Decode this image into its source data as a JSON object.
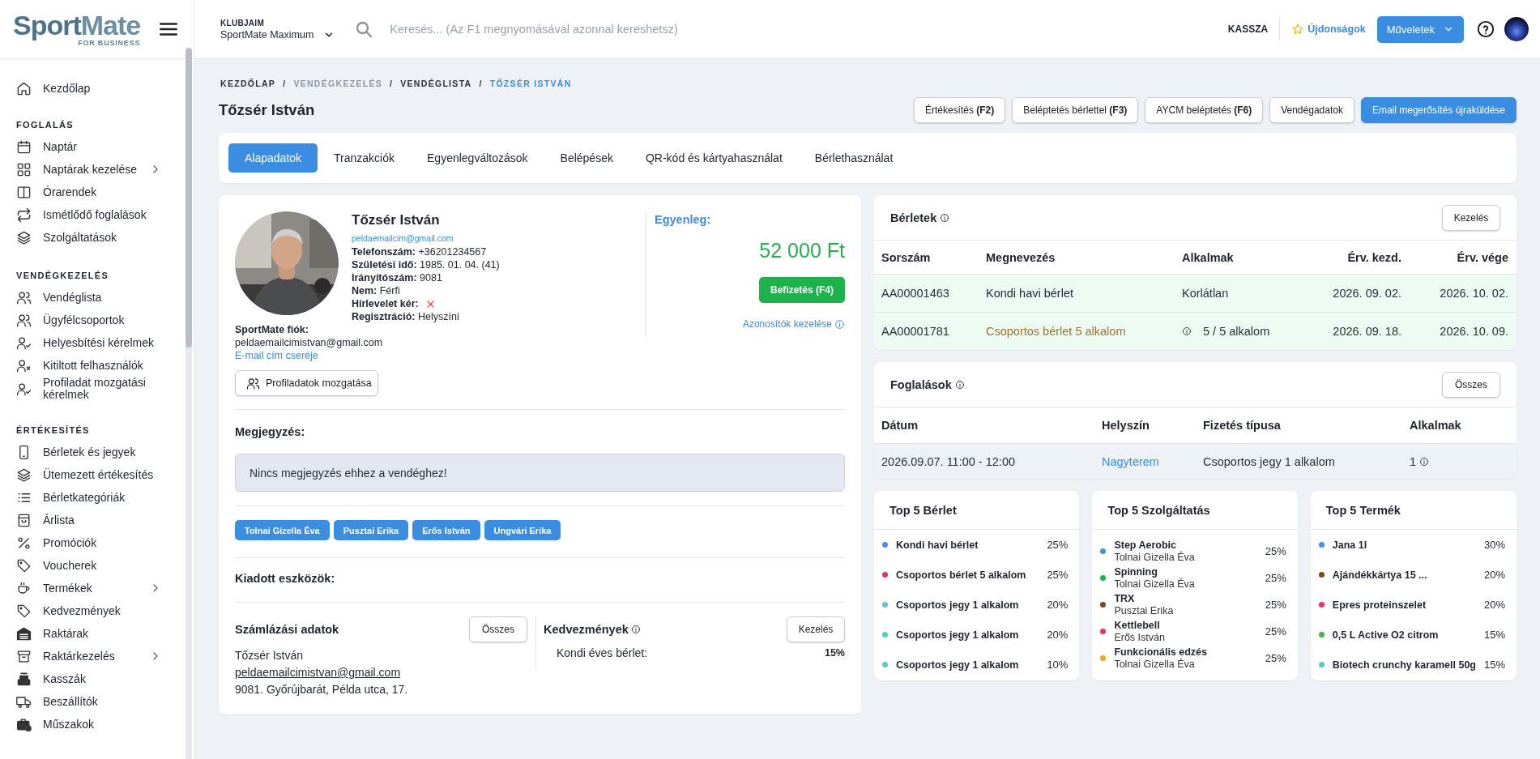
{
  "logo": {
    "wordmark_1": "Sport",
    "wordmark_2": "Mate",
    "tagline": "FOR BUSINESS"
  },
  "sidebar": {
    "sections": [
      {
        "items": [
          {
            "label": "Kezdőlap",
            "has_submenu": false
          }
        ]
      },
      {
        "title": "FOGLALÁS",
        "items": [
          {
            "label": "Naptár",
            "has_submenu": false
          },
          {
            "label": "Naptárak kezelése",
            "has_submenu": true
          },
          {
            "label": "Órarendek",
            "has_submenu": false
          },
          {
            "label": "Ismétlődő foglalások",
            "has_submenu": false
          },
          {
            "label": "Szolgáltatások",
            "has_submenu": false
          }
        ]
      },
      {
        "title": "VENDÉGKEZELÉS",
        "items": [
          {
            "label": "Vendéglista",
            "has_submenu": false
          },
          {
            "label": "Ügyfélcsoportok",
            "has_submenu": false
          },
          {
            "label": "Helyesbítési kérelmek",
            "has_submenu": false
          },
          {
            "label": "Kitiltott felhasználók",
            "has_submenu": false
          },
          {
            "label": "Profiladat mozgatási kérelmek",
            "has_submenu": false
          }
        ]
      },
      {
        "title": "ÉRTÉKESÍTÉS",
        "items": [
          {
            "label": "Bérletek és jegyek",
            "has_submenu": false
          },
          {
            "label": "Ütemezett értékesítés",
            "has_submenu": false
          },
          {
            "label": "Bérletkategóriák",
            "has_submenu": false
          },
          {
            "label": "Árlista",
            "has_submenu": false
          },
          {
            "label": "Promóciók",
            "has_submenu": false
          },
          {
            "label": "Voucherek",
            "has_submenu": false
          },
          {
            "label": "Termékek",
            "has_submenu": true
          },
          {
            "label": "Kedvezmények",
            "has_submenu": false
          },
          {
            "label": "Raktárak",
            "has_submenu": false
          },
          {
            "label": "Raktárkezelés",
            "has_submenu": true
          },
          {
            "label": "Kasszák",
            "has_submenu": false
          },
          {
            "label": "Beszállítók",
            "has_submenu": false
          },
          {
            "label": "Műszakok",
            "has_submenu": false
          }
        ]
      }
    ]
  },
  "topbar": {
    "club_label": "KLUBJAIM",
    "club": "SportMate Maximum",
    "search": {
      "placeholder": "Keresés... (Az F1 megnyomásával azonnal kereshetsz)"
    },
    "register_link": "KASSZA",
    "news_link": "Újdonságok",
    "actions_button": "Műveletek"
  },
  "breadcrumbs": [
    {
      "label": "KEZDŐLAP",
      "kind": "link"
    },
    {
      "label": "/",
      "kind": "separator"
    },
    {
      "label": "VENDÉGKEZELÉS",
      "kind": "muted"
    },
    {
      "label": "/",
      "kind": "separator"
    },
    {
      "label": "VENDÉGLISTA",
      "kind": "link"
    },
    {
      "label": "/",
      "kind": "separator"
    },
    {
      "label": "TŐZSÉR ISTVÁN",
      "kind": "current"
    }
  ],
  "page_title": "Tőzsér István",
  "action_buttons": [
    {
      "label": "Értékesítés **(F2)**",
      "kind": "default"
    },
    {
      "label": "Beléptetés bérlettel **(F3)**",
      "kind": "default"
    },
    {
      "label": "AYCM beléptetés **(F6)**",
      "kind": "default"
    },
    {
      "label": "Vendégadatok",
      "kind": "default"
    },
    {
      "label": "Email megerősítés újraküldése",
      "kind": "primary"
    }
  ],
  "tabs": [
    {
      "label": "Alapadatok",
      "selected": true
    },
    {
      "label": "Tranzakciók",
      "selected": false
    },
    {
      "label": "Egyenlegváltozások",
      "selected": false
    },
    {
      "label": "Belépések",
      "selected": false
    },
    {
      "label": "QR-kód és kártyahasználat",
      "selected": false
    },
    {
      "label": "Bérlethasználat",
      "selected": false
    }
  ],
  "profile": {
    "photo": {
      "kind": "picture"
    },
    "name": "Tőzsér István",
    "email": "peldaemailcim@gmail.com",
    "fields": [
      {
        "kind": "text",
        "label": "Telefonszám:",
        "value": "+36201234567"
      },
      {
        "kind": "text",
        "label": "Születési idő:",
        "value": "1985. 01. 04. (41)"
      },
      {
        "kind": "text",
        "label": "Irányítószám:",
        "value": "9081"
      },
      {
        "kind": "text",
        "label": "Nem:",
        "value": "Férfi"
      },
      {
        "kind": "flag",
        "label": "Hírlevelet kér:",
        "on": false
      },
      {
        "kind": "text",
        "label": "Regisztráció:",
        "value": "Helyszíni"
      }
    ],
    "account_label": "SportMate fiók:",
    "account_email": "peldaemailcimistvan@gmail.com",
    "change_email_link": "E-mail cím cseréje",
    "move_button": "Profiladatok mozgatása",
    "balance": {
      "label": "Egyenleg:",
      "amount": "52 000 Ft",
      "pay_button": "Befizetés (F4)",
      "ids_link": "Azonosítók kezelése"
    },
    "note_label": "Megjegyzés:",
    "note": "Nincs megjegyzés ehhez a vendéghez!",
    "trainers": [
      "Tolnai Gizella Éva",
      "Pusztai Erika",
      "Erős István",
      "Ungvári Erika"
    ],
    "devices_label": "Kiadott eszközök:",
    "billing": {
      "title": "Számlázási adatok",
      "button": "Összes",
      "name": "Tőzsér István",
      "email": "peldaemailcimistvan@gmail.com",
      "address": "9081. Győrújbarát, Példa utca, 17."
    },
    "discounts": {
      "title": "Kedvezmények",
      "button": "Kezelés",
      "rows": [
        {
          "name": "Kondi éves bérlet:",
          "value": "15%"
        }
      ]
    }
  },
  "passes": {
    "title": "Bérletek",
    "button": "Kezelés",
    "columns": [
      "Sorszám",
      "Megnevezés",
      "Alkalmak",
      "Érv. kezd.",
      "Érv. vége"
    ],
    "rows": [
      {
        "active": true,
        "used_up": false,
        "has_info": false,
        "cells": [
          "AA00001463",
          "Kondi havi bérlet",
          "Korlátlan",
          "2026. 09. 02.",
          "2026. 10. 02."
        ]
      },
      {
        "active": true,
        "used_up": true,
        "has_info": true,
        "cells": [
          "AA00001781",
          "Csoportos bérlet 5 alkalom",
          "5 / 5 alkalom",
          "2026. 09. 18.",
          "2026. 10. 09."
        ]
      }
    ]
  },
  "bookings": {
    "title": "Foglalások",
    "button": "Összes",
    "columns": [
      "Dátum",
      "Helyszín",
      "Fizetés típusa",
      "Alkalmak"
    ],
    "rows": [
      {
        "cells": [
          "2026.09.07. 11:00 - 12:00",
          "Nagyterem",
          "Csoportos jegy 1 alkalom",
          "1"
        ]
      }
    ]
  },
  "top5": [
    {
      "title": "Top 5 Bérlet",
      "items": [
        {
          "name": "Kondi havi bérlet",
          "percent": "25%",
          "color": "#4a8fd8"
        },
        {
          "name": "Csoportos bérlet 5 alkalom",
          "percent": "25%",
          "color": "#e2336f"
        },
        {
          "name": "Csoportos jegy 1 alkalom",
          "percent": "20%",
          "color": "#5cc9c9"
        },
        {
          "name": "Csoportos jegy 1 alkalom",
          "percent": "20%",
          "color": "#5cc9c9"
        },
        {
          "name": "Csoportos jegy 1 alkalom",
          "percent": "10%",
          "color": "#5cc9c9"
        }
      ]
    },
    {
      "title": "Top 5 Szolgáltatás",
      "items": [
        {
          "name": "Step Aerobic",
          "trainer": "Tolnai Gizella Éva",
          "percent": "25%",
          "color": "#4a8fd8"
        },
        {
          "name": "Spinning",
          "trainer": "Tolnai Gizella Éva",
          "percent": "25%",
          "color": "#1faf4b"
        },
        {
          "name": "TRX",
          "trainer": "Pusztai Erika",
          "percent": "25%",
          "color": "#7b4a1d"
        },
        {
          "name": "Kettlebell",
          "trainer": "Erős István",
          "percent": "25%",
          "color": "#e2336f"
        },
        {
          "name": "Funkcionális edzés",
          "trainer": "Tolnai Gizella Éva",
          "percent": "25%",
          "color": "#f5a623"
        }
      ]
    },
    {
      "title": "Top 5 Termék",
      "items": [
        {
          "name": "Jana 1l",
          "percent": "30%",
          "color": "#4a8fd8"
        },
        {
          "name": "Ajándékkártya 15 ...",
          "percent": "20%",
          "color": "#7b4a1d"
        },
        {
          "name": "Epres proteinszelet",
          "percent": "20%",
          "color": "#e2336f"
        },
        {
          "name": "0,5 L Active O2 citrom",
          "percent": "15%",
          "color": "#4caf50"
        },
        {
          "name": "Biotech crunchy karamell 50g",
          "percent": "15%",
          "color": "#5cc9c9"
        }
      ]
    }
  ]
}
